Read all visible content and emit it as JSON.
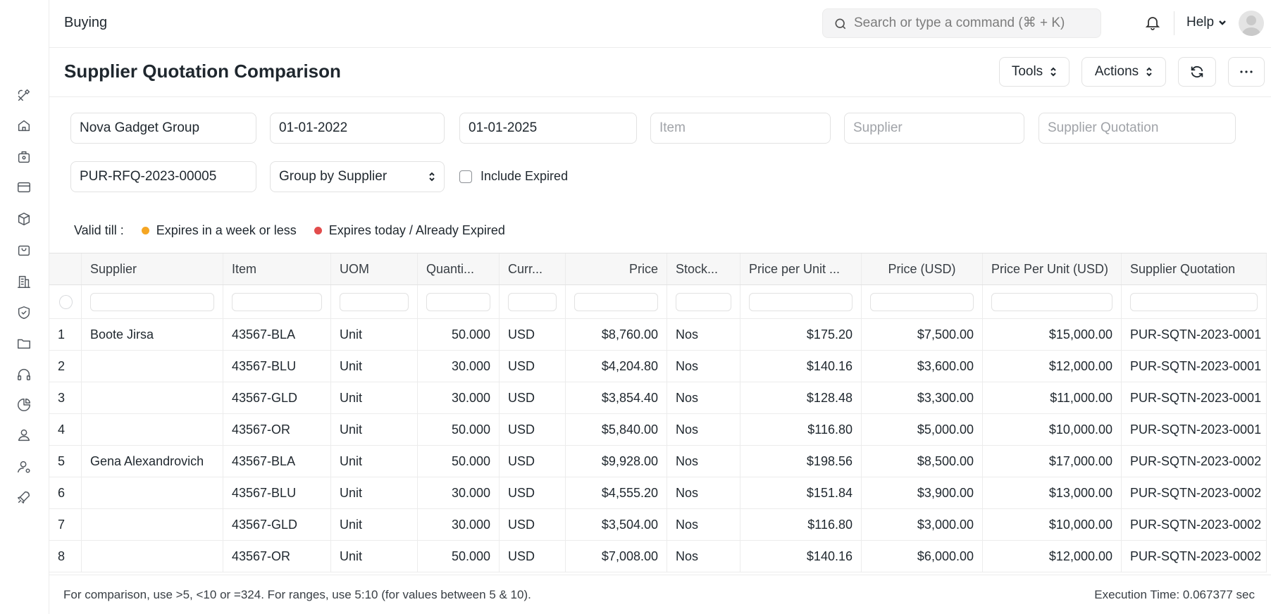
{
  "navbar": {
    "breadcrumb": "Buying",
    "search_placeholder": "Search or type a command (⌘ + K)",
    "help_label": "Help"
  },
  "sidebar": {
    "icons": [
      "tools-icon",
      "home-icon",
      "briefcase-icon",
      "card-icon",
      "package-icon",
      "bag-icon",
      "building-icon",
      "shield-check-icon",
      "folder-icon",
      "headset-icon",
      "chart-pie-icon",
      "user-icon",
      "user-settings-icon",
      "rocket-icon"
    ]
  },
  "page": {
    "title": "Supplier Quotation Comparison",
    "tools_label": "Tools",
    "actions_label": "Actions"
  },
  "filters": {
    "company": "Nova Gadget Group",
    "from_date": "01-01-2022",
    "to_date": "01-01-2025",
    "item_placeholder": "Item",
    "supplier_placeholder": "Supplier",
    "supplier_quotation_placeholder": "Supplier Quotation",
    "rfq": "PUR-RFQ-2023-00005",
    "group_by": "Group by Supplier",
    "include_expired_label": "Include Expired"
  },
  "legend": {
    "label": "Valid till :",
    "items": [
      {
        "text": "Expires in a week or less",
        "color": "#f5a623"
      },
      {
        "text": "Expires today / Already Expired",
        "color": "#e24c4c"
      }
    ]
  },
  "table": {
    "columns": [
      "Supplier",
      "Item",
      "UOM",
      "Quanti...",
      "Curr...",
      "Price",
      "Stock...",
      "Price per Unit ...",
      "Price (USD)",
      "Price Per Unit (USD)",
      "Supplier Quotation"
    ],
    "rows": [
      [
        "1",
        "Boote Jirsa",
        "43567-BLA",
        "Unit",
        "50.000",
        "USD",
        "$8,760.00",
        "Nos",
        "$175.20",
        "$7,500.00",
        "$15,000.00",
        "PUR-SQTN-2023-0001"
      ],
      [
        "2",
        "",
        "43567-BLU",
        "Unit",
        "30.000",
        "USD",
        "$4,204.80",
        "Nos",
        "$140.16",
        "$3,600.00",
        "$12,000.00",
        "PUR-SQTN-2023-0001"
      ],
      [
        "3",
        "",
        "43567-GLD",
        "Unit",
        "30.000",
        "USD",
        "$3,854.40",
        "Nos",
        "$128.48",
        "$3,300.00",
        "$11,000.00",
        "PUR-SQTN-2023-0001"
      ],
      [
        "4",
        "",
        "43567-OR",
        "Unit",
        "50.000",
        "USD",
        "$5,840.00",
        "Nos",
        "$116.80",
        "$5,000.00",
        "$10,000.00",
        "PUR-SQTN-2023-0001"
      ],
      [
        "5",
        "Gena Alexandrovich",
        "43567-BLA",
        "Unit",
        "50.000",
        "USD",
        "$9,928.00",
        "Nos",
        "$198.56",
        "$8,500.00",
        "$17,000.00",
        "PUR-SQTN-2023-0002"
      ],
      [
        "6",
        "",
        "43567-BLU",
        "Unit",
        "30.000",
        "USD",
        "$4,555.20",
        "Nos",
        "$151.84",
        "$3,900.00",
        "$13,000.00",
        "PUR-SQTN-2023-0002"
      ],
      [
        "7",
        "",
        "43567-GLD",
        "Unit",
        "30.000",
        "USD",
        "$3,504.00",
        "Nos",
        "$116.80",
        "$3,000.00",
        "$10,000.00",
        "PUR-SQTN-2023-0002"
      ],
      [
        "8",
        "",
        "43567-OR",
        "Unit",
        "50.000",
        "USD",
        "$7,008.00",
        "Nos",
        "$140.16",
        "$6,000.00",
        "$12,000.00",
        "PUR-SQTN-2023-0002"
      ]
    ]
  },
  "footer": {
    "note": "For comparison, use >5, <10 or =324. For ranges, use 5:10 (for values between 5 & 10).",
    "execution_time": "Execution Time: 0.067377 sec"
  }
}
